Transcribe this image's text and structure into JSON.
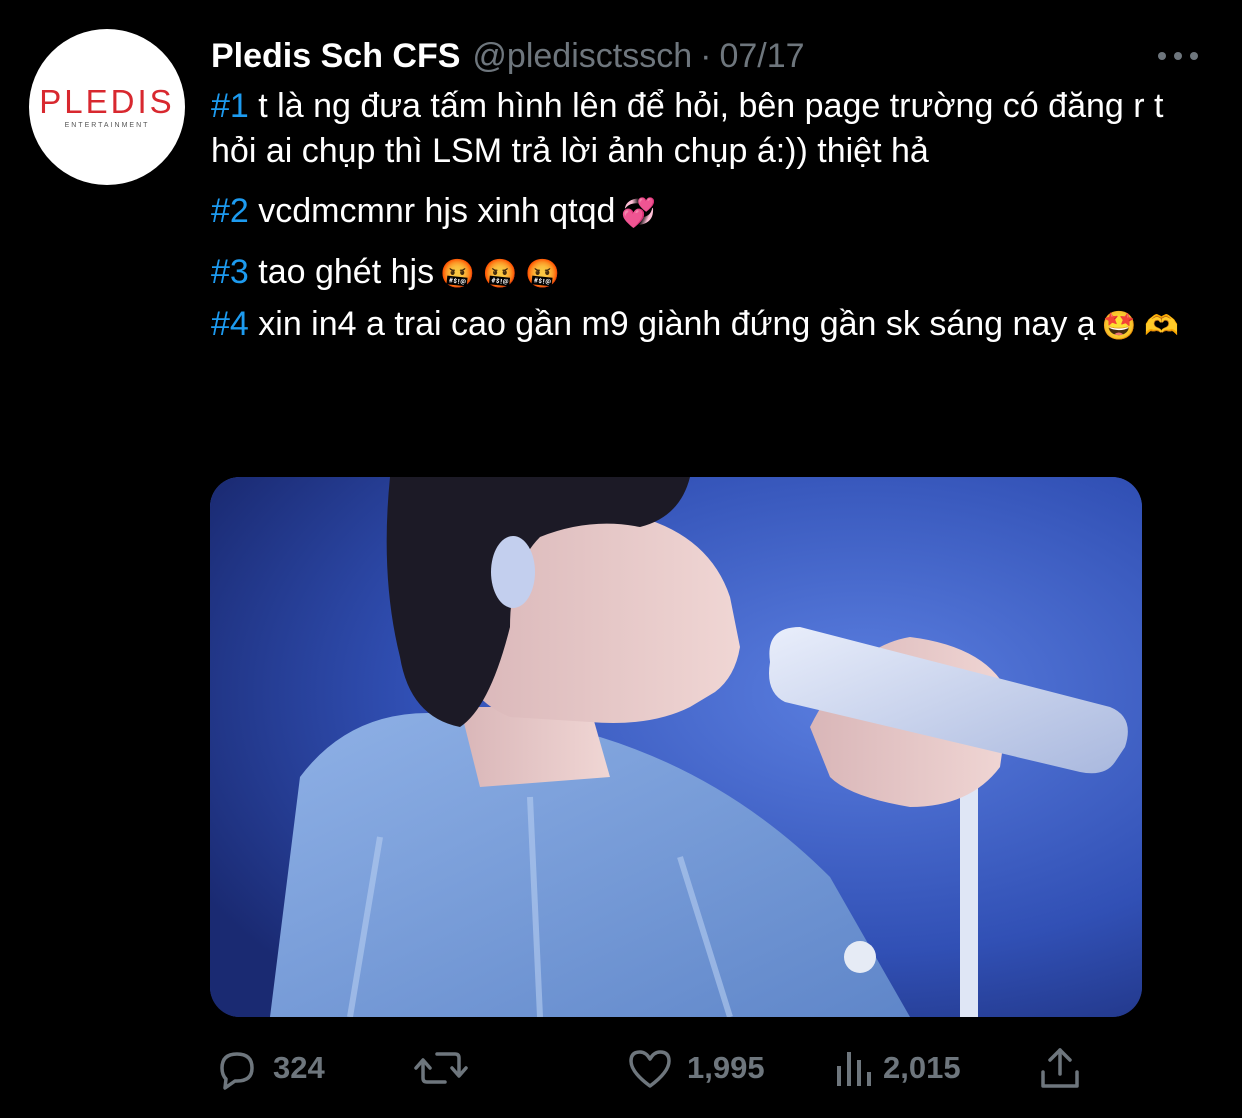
{
  "avatar": {
    "logo_text": "PLEDIS",
    "logo_subtext": "ENTERTAINMENT"
  },
  "tweet": {
    "display_name": "Pledis Sch CFS",
    "handle": "@pledisctssch",
    "separator": "·",
    "date": "07/17",
    "paragraphs": [
      {
        "tag": "#1",
        "text": " t là ng đưa tấm hình lên để hỏi, bên page trường có đăng r t hỏi ai chụp thì LSM trả lời ảnh chụp á:)) thiệt hả"
      },
      {
        "tag": "#2",
        "text": " vcdmcmnr hjs xinh qtqd",
        "emoji": "💞"
      },
      {
        "tag": "#3",
        "text": " tao ghét hjs",
        "emoji": "🤬 🤬 🤬"
      },
      {
        "tag": "#4",
        "text": " xin in4 a trai cao gần m9 giành đứng gần sk sáng nay ạ",
        "emoji": "🤩 🫶"
      }
    ]
  },
  "metrics": {
    "replies": "324",
    "retweets": "",
    "likes": "1,995",
    "views": "2,015"
  },
  "icons": {
    "reply": "reply-icon",
    "retweet": "retweet-icon",
    "like": "heart-icon",
    "views": "analytics-icon",
    "share": "share-icon",
    "more": "more-icon"
  },
  "colors": {
    "background": "#000000",
    "hashtag": "#1d9bf0",
    "muted": "#6e767d",
    "brand_red": "#d8282f"
  }
}
